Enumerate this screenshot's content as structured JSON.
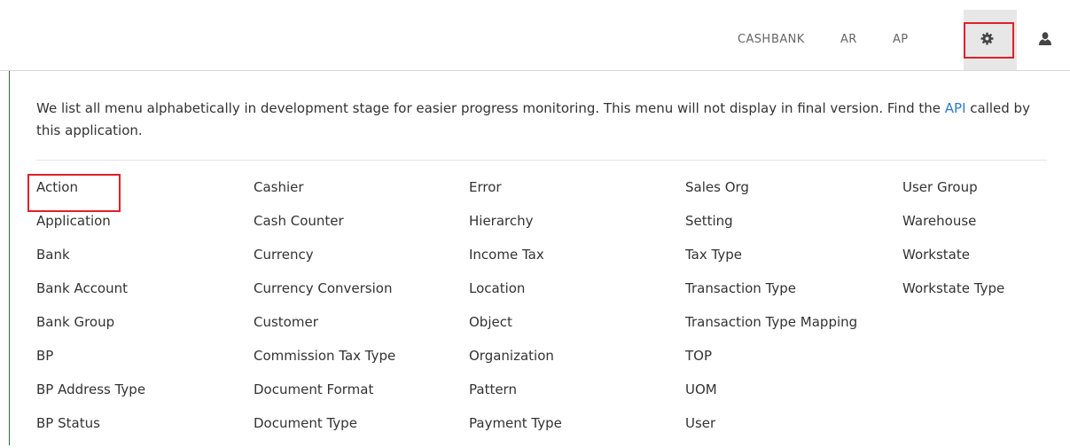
{
  "topnav": {
    "items": [
      {
        "label": "CASH"
      },
      {
        "label": "BANK"
      },
      {
        "label": "AR"
      },
      {
        "label": "AP"
      }
    ],
    "settings_icon": "gear-icon",
    "user_icon": "user-icon",
    "active_item": "settings",
    "highlight_color": "#e0202b",
    "accent_rule_color": "#2e6d38"
  },
  "intro": {
    "text_before": "We list all menu alphabetically in development stage for easier progress monitoring. This menu will not display in final version. Find the ",
    "link_text": "API",
    "text_after": " called by this application.",
    "link_color": "#2a7bd2"
  },
  "menu": {
    "columns": [
      [
        "Action",
        "Application",
        "Bank",
        "Bank Account",
        "Bank Group",
        "BP",
        "BP Address Type",
        "BP Status"
      ],
      [
        "Cashier",
        "Cash Counter",
        "Currency",
        "Currency Conversion",
        "Customer",
        "Commission Tax Type",
        "Document Format",
        "Document Type"
      ],
      [
        "Error",
        "Hierarchy",
        "Income Tax",
        "Location",
        "Object",
        "Organization",
        "Pattern",
        "Payment Type"
      ],
      [
        "Sales Org",
        "Setting",
        "Tax Type",
        "Transaction Type",
        "Transaction Type Mapping",
        "TOP",
        "UOM",
        "User"
      ],
      [
        "User Group",
        "Warehouse",
        "Workstate",
        "Workstate Type"
      ]
    ],
    "highlighted_item": "Action"
  }
}
